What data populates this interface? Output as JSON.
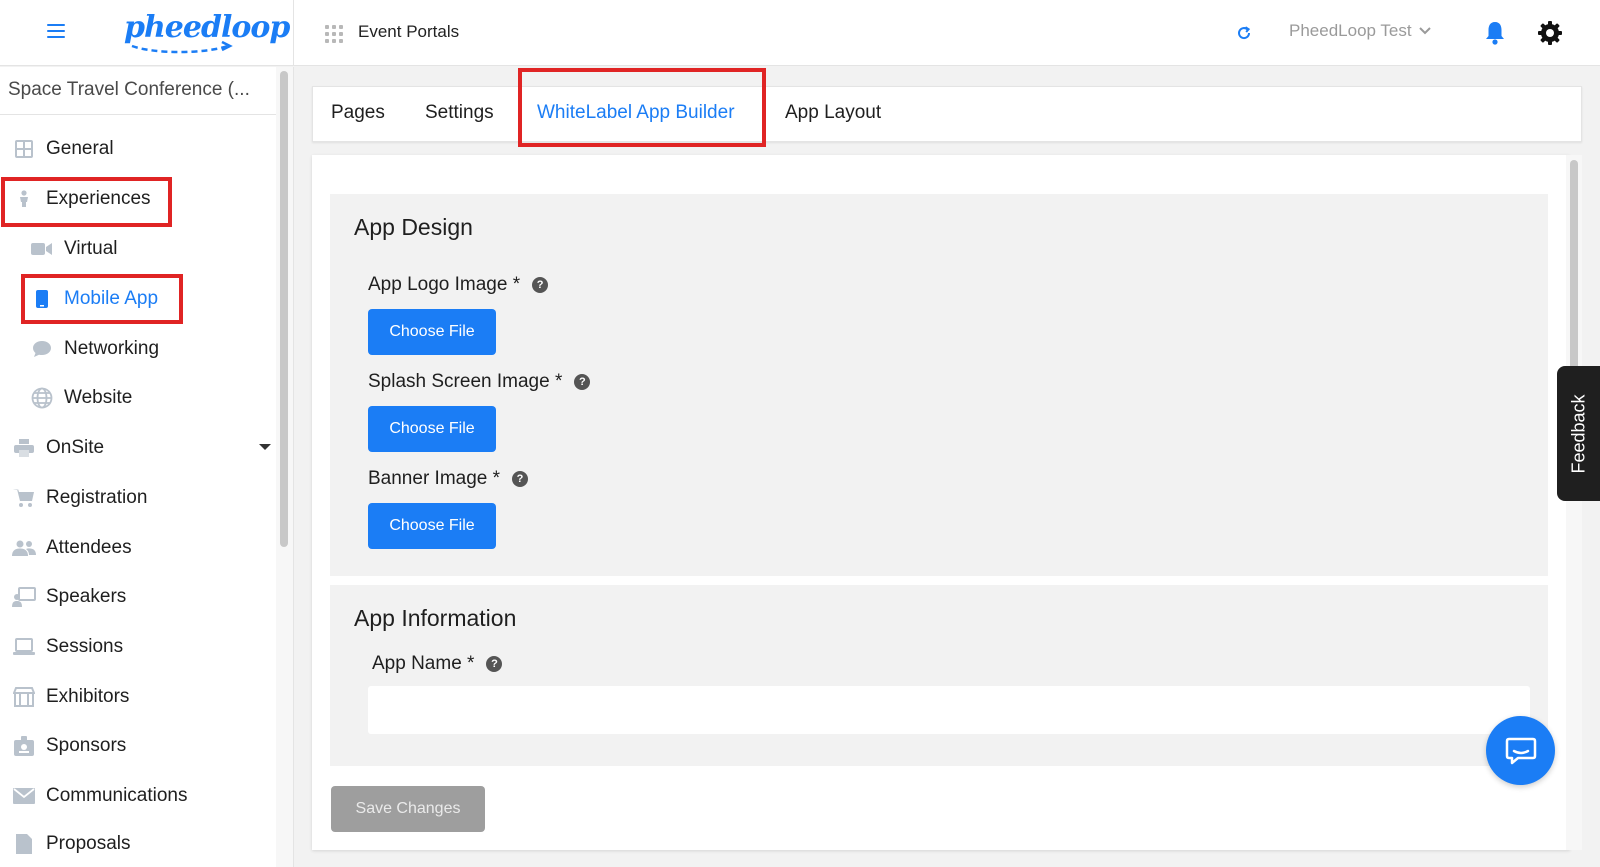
{
  "header": {
    "portal_title": "Event Portals",
    "account_name": "PheedLoop Test"
  },
  "brand": {
    "logo_text": "pheedloop",
    "accent": "#1b7df5",
    "highlight": "#e02424"
  },
  "sidebar": {
    "event_name": "Space Travel Conference (...",
    "items": [
      {
        "label": "General",
        "icon": "grid-icon"
      },
      {
        "label": "Experiences",
        "icon": "person-icon",
        "highlighted": true
      },
      {
        "label": "Virtual",
        "icon": "video-camera-icon"
      },
      {
        "label": "Mobile App",
        "icon": "mobile-phone-icon",
        "active": true,
        "highlighted": true
      },
      {
        "label": "Networking",
        "icon": "chat-bubble-icon"
      },
      {
        "label": "Website",
        "icon": "globe-icon"
      },
      {
        "label": "OnSite",
        "icon": "printer-icon",
        "has_dropdown": true
      },
      {
        "label": "Registration",
        "icon": "cart-icon"
      },
      {
        "label": "Attendees",
        "icon": "people-icon"
      },
      {
        "label": "Speakers",
        "icon": "presenter-icon"
      },
      {
        "label": "Sessions",
        "icon": "laptop-icon"
      },
      {
        "label": "Exhibitors",
        "icon": "storefront-icon"
      },
      {
        "label": "Sponsors",
        "icon": "badge-icon"
      },
      {
        "label": "Communications",
        "icon": "envelope-icon"
      },
      {
        "label": "Proposals",
        "icon": "document-icon"
      }
    ]
  },
  "tabs": [
    {
      "label": "Pages"
    },
    {
      "label": "Settings"
    },
    {
      "label": "WhiteLabel App Builder",
      "active": true,
      "highlighted": true
    },
    {
      "label": "App Layout"
    }
  ],
  "app_design": {
    "title": "App Design",
    "fields": [
      {
        "label": "App Logo Image *",
        "button": "Choose File"
      },
      {
        "label": "Splash Screen Image *",
        "button": "Choose File"
      },
      {
        "label": "Banner Image *",
        "button": "Choose File"
      }
    ]
  },
  "app_information": {
    "title": "App Information",
    "app_name_label": "App Name *",
    "app_name_value": ""
  },
  "help_glyph": "?",
  "save_button": "Save Changes",
  "feedback_label": "Feedback"
}
